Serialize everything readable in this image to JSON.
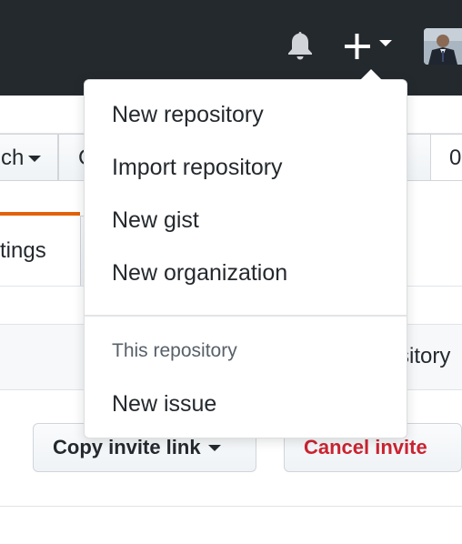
{
  "header": {
    "notifications_icon": "bell-icon",
    "create_icon": "plus-icon",
    "avatar_icon": "user-avatar"
  },
  "background": {
    "branch_button_partial": "ch",
    "second_button_partial": "C",
    "right_button_partial": "0",
    "tab_partial": "tings",
    "bar_text_partial": "sitory",
    "copy_invite_link": "Copy invite link",
    "cancel_invite": "Cancel invite"
  },
  "dropdown": {
    "items": [
      {
        "label": "New repository"
      },
      {
        "label": "Import repository"
      },
      {
        "label": "New gist"
      },
      {
        "label": "New organization"
      }
    ],
    "section_header": "This repository",
    "section_items": [
      {
        "label": "New issue"
      }
    ]
  },
  "colors": {
    "header_bg": "#24292e",
    "accent_underline": "#e36209",
    "danger_text": "#cb2431"
  }
}
